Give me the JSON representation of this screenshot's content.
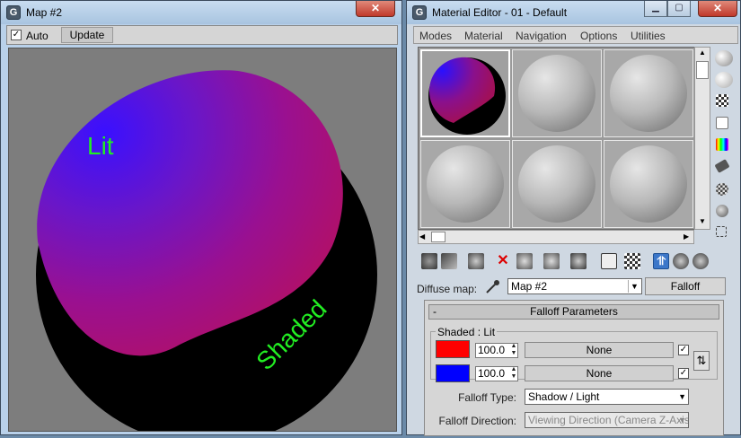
{
  "map_window": {
    "title": "Map #2",
    "auto_label": "Auto",
    "auto_checked": true,
    "update_label": "Update",
    "preview": {
      "lit_label": "Lit",
      "shaded_label": "Shaded",
      "lit_color": "#3a18f5",
      "shaded_color": "#c0126a",
      "label_color": "#22ee22"
    }
  },
  "material_editor": {
    "title": "Material Editor - 01 - Default",
    "close_symbol": "✕",
    "menu": [
      "Modes",
      "Material",
      "Navigation",
      "Options",
      "Utilities"
    ],
    "slot_count": 6,
    "diffuse_map_label": "Diffuse map:",
    "map_selected": "Map #2",
    "map_type_button": "Falloff",
    "rollout": {
      "title": "Falloff Parameters",
      "collapse_symbol": "-",
      "group_label": "Shaded : Lit",
      "row1": {
        "color": "#ff0000",
        "amount": "100.0",
        "map": "None",
        "checked": true
      },
      "row2": {
        "color": "#0000ff",
        "amount": "100.0",
        "map": "None",
        "checked": true
      },
      "falloff_type_label": "Falloff Type:",
      "falloff_type_value": "Shadow / Light",
      "falloff_direction_label": "Falloff Direction:",
      "falloff_direction_value": "Viewing Direction (Camera Z-Axis)"
    }
  }
}
